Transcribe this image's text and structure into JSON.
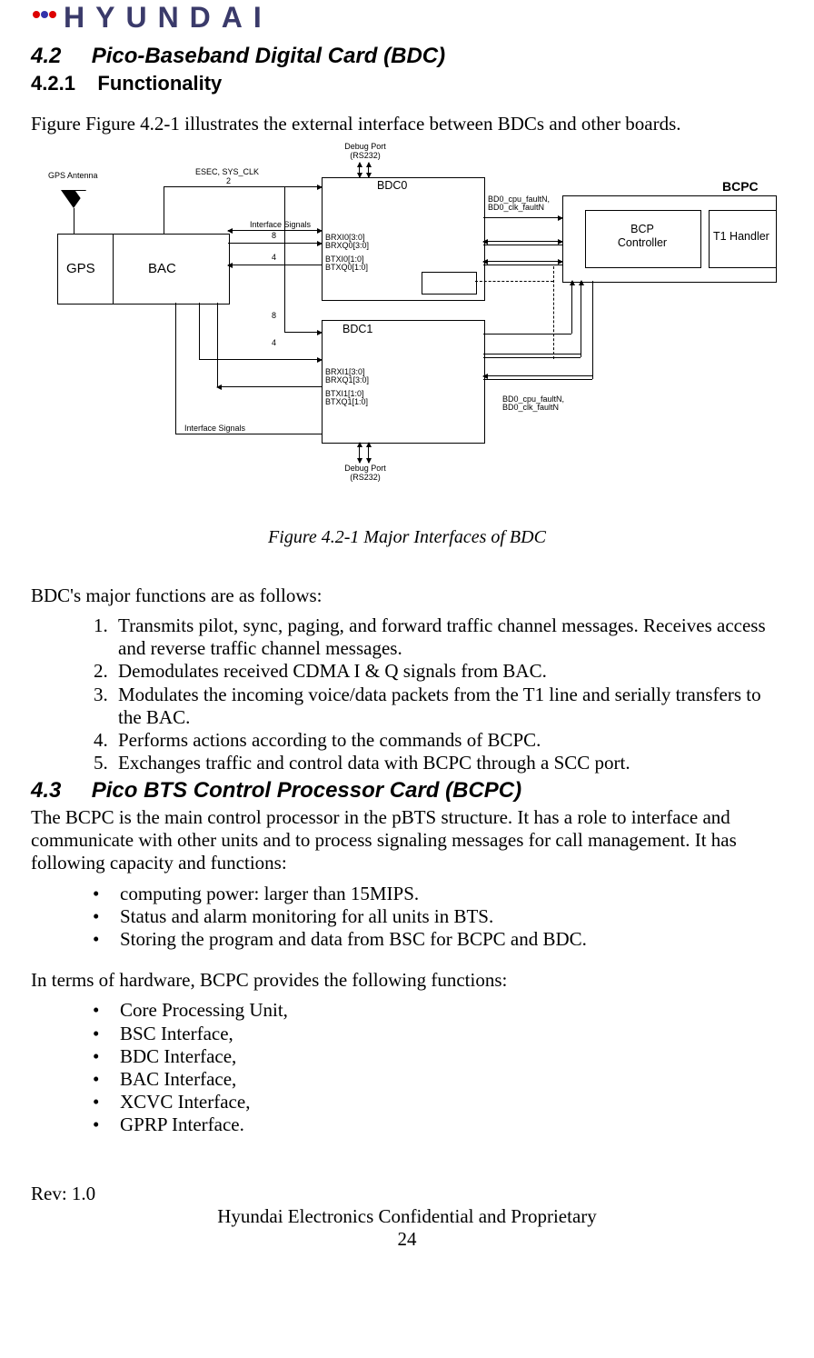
{
  "logo": {
    "brand": "HYUNDAI"
  },
  "section42": {
    "num": "4.2",
    "title": "Pico-Baseband Digital Card (BDC)",
    "sub_num": "4.2.1",
    "sub_title": "Functionality",
    "intro": "Figure Figure 4.2-1 illustrates the external interface between BDCs and other boards."
  },
  "figure": {
    "caption": "Figure 4.2-1 Major Interfaces of BDC",
    "labels": {
      "gps_antenna": "GPS Antenna",
      "esec": "ESEC, SYS_CLK",
      "two": "2",
      "gps": "GPS",
      "bac": "BAC",
      "iface": "Interface Signals",
      "iface2": "Interface Signals",
      "eight": "8",
      "four": "4",
      "eight2": "8",
      "four2": "4",
      "brxi0": "BRXI0[3:0]",
      "brxq0": "BRXQ0[3:0]",
      "btxi0": "BTXI0[1:0]",
      "btxq0": "BTXQ0[1:0]",
      "brxi1": "BRXI1[3:0]",
      "brxq1": "BRXQ1[3:0]",
      "btxi1": "BTXI1[1:0]",
      "btxq1": "BTXQ1[1:0]",
      "debug_top": "Debug Port",
      "debug_top2": "(RS232)",
      "debug_bot": "Debug Port",
      "debug_bot2": "(RS232)",
      "bdc0": "BDC0",
      "bdc1": "BDC1",
      "bcpc": "BCPC",
      "bcp_ctrl": "BCP",
      "bcp_ctrl2": "Controller",
      "t1": "T1 Handler",
      "fault0": "BD0_cpu_faultN,",
      "fault0b": "BD0_clk_faultN",
      "fault1": "BD0_cpu_faultN,",
      "fault1b": "BD0_clk_faultN"
    }
  },
  "bdc_functions": {
    "intro": "BDC's major functions are as follows:",
    "items": [
      "Transmits pilot, sync, paging, and forward traffic channel messages. Receives access and  reverse traffic channel messages.",
      "Demodulates received CDMA I & Q signals from BAC.",
      "Modulates the incoming voice/data packets from the T1 line and serially transfers to the BAC.",
      "Performs actions according to the commands of BCPC.",
      "Exchanges traffic and control data with BCPC through a SCC port."
    ]
  },
  "section43": {
    "num": "4.3",
    "title": "Pico BTS Control Processor Card (BCPC)",
    "para": "The BCPC is the main control processor in the pBTS structure. It has a role to interface and communicate with other units and to process signaling messages for call management. It has following capacity and functions:",
    "bullets1": [
      "computing power: larger than 15MIPS.",
      "Status and alarm monitoring for all units in BTS.",
      "Storing the program and data from BSC for BCPC and BDC."
    ],
    "para2": "In terms of hardware, BCPC provides the following functions:",
    "bullets2": [
      "Core Processing Unit,",
      "BSC Interface,",
      "BDC Interface,",
      "BAC Interface,",
      "XCVC Interface,",
      "GPRP Interface."
    ]
  },
  "footer": {
    "rev": "Rev: 1.0",
    "conf": "Hyundai Electronics Confidential and Proprietary",
    "page": "24"
  }
}
